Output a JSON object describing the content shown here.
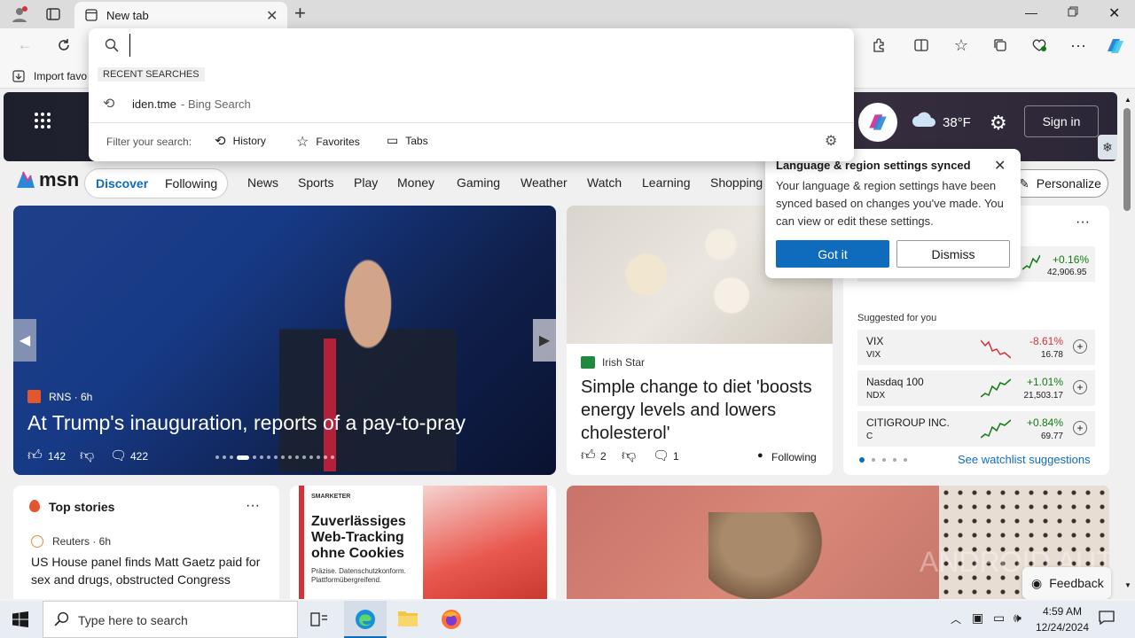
{
  "browser": {
    "tab_title": "New tab",
    "favorites_label": "Import favo",
    "address_value": ""
  },
  "dropdown": {
    "recent_header": "RECENT SEARCHES",
    "recent_item": "iden.tme",
    "recent_item_suffix": " - Bing Search",
    "filter_label": "Filter your search:",
    "filters": [
      "History",
      "Favorites",
      "Tabs"
    ]
  },
  "msn": {
    "logo": "msn",
    "temperature": "38°F",
    "sign_in": "Sign in",
    "tabs": [
      "Discover",
      "Following"
    ],
    "nav": [
      "News",
      "Sports",
      "Play",
      "Money",
      "Gaming",
      "Weather",
      "Watch",
      "Learning",
      "Shopping"
    ],
    "personalize": "Personalize"
  },
  "popup": {
    "title": "Language & region settings synced",
    "body": "Your language & region settings have been synced based on changes you've made. You can view or edit these settings.",
    "primary": "Got it",
    "secondary": "Dismiss"
  },
  "hero": {
    "source": "RNS · 6h",
    "headline": "At Trump's inauguration, reports of a pay-to-pray",
    "likes": "142",
    "comments": "422"
  },
  "article2": {
    "source": "Irish Star",
    "headline": "Simple change to diet 'boosts energy levels and lowers cholesterol'",
    "likes": "2",
    "comments": "1",
    "following": "Following"
  },
  "watchlist": {
    "top_change": "+0.16%",
    "top_value": "42,906.95",
    "suggested_label": "Suggested for you",
    "items": [
      {
        "name": "VIX",
        "symbol": "VIX",
        "change": "-8.61%",
        "value": "16.78",
        "color": "#d13438"
      },
      {
        "name": "Nasdaq 100",
        "symbol": "NDX",
        "change": "+1.01%",
        "value": "21,503.17",
        "color": "#107c10"
      },
      {
        "name": "CITIGROUP INC.",
        "symbol": "C",
        "change": "+0.84%",
        "value": "69.77",
        "color": "#107c10"
      }
    ],
    "see_more": "See watchlist suggestions"
  },
  "top_stories": {
    "title": "Top stories",
    "source": "Reuters · 6h",
    "headline": "US House panel finds Matt Gaetz paid for sex and drugs, obstructed Congress"
  },
  "ad": {
    "brand": "SMARKETER",
    "headline": "Zuverlässiges Web-Tracking ohne Cookies",
    "sub": "Präzise. Datenschutzkonform. Plattformübergreifend."
  },
  "monkey": {
    "watermark": "ANDROID AUTHORITY",
    "feedback": "Feedback"
  },
  "taskbar": {
    "search_placeholder": "Type here to search",
    "time": "4:59 AM",
    "date": "12/24/2024"
  }
}
